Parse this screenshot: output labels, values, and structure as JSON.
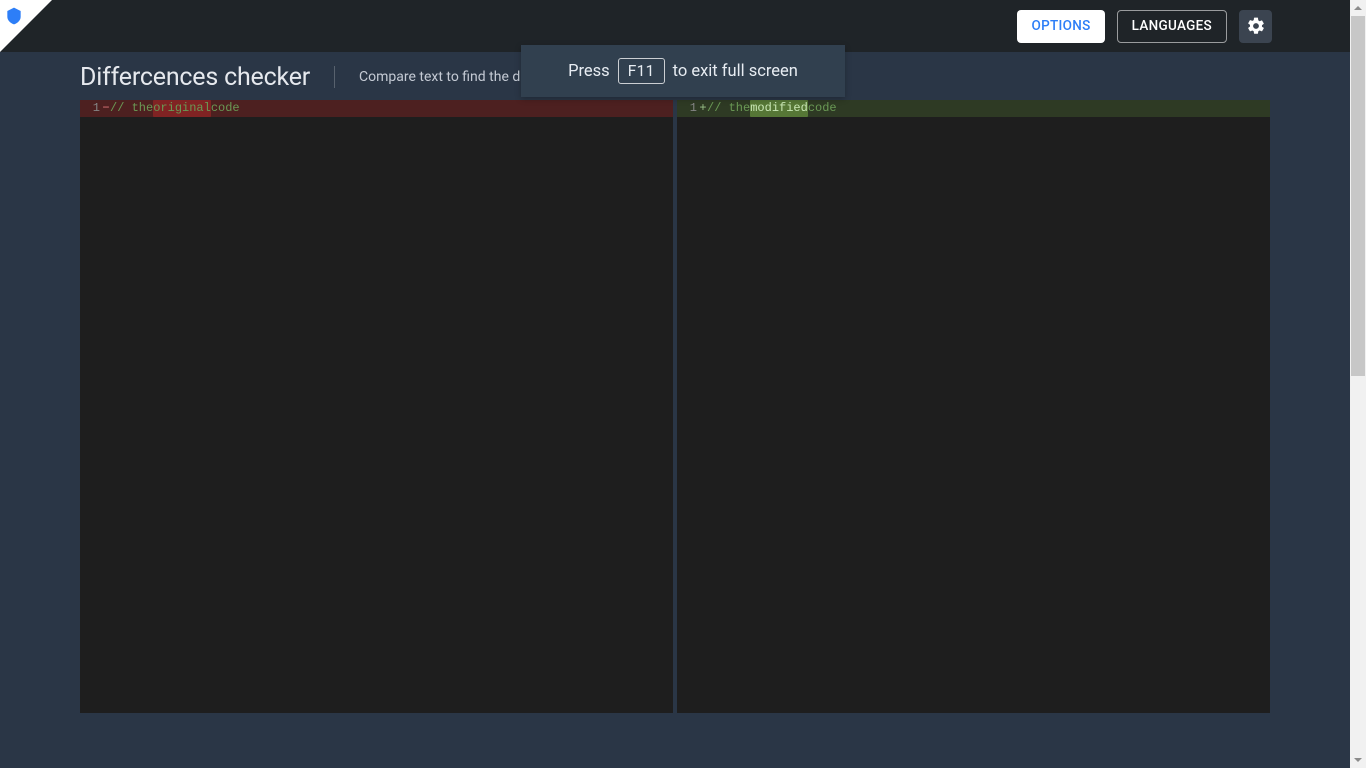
{
  "header": {
    "options_label": "OPTIONS",
    "languages_label": "LANGUAGES"
  },
  "title": {
    "main": "Differcences checker",
    "sub": "Compare text to find the difference between two text files."
  },
  "diff": {
    "left": {
      "line_number": "1",
      "sign": "−",
      "prefix": "// the ",
      "changed": "original",
      "suffix": " code"
    },
    "right": {
      "line_number": "1",
      "sign": "+",
      "prefix": "// the ",
      "changed": "modified",
      "suffix": " code"
    }
  },
  "overlay": {
    "before": "Press",
    "key": "F11",
    "after": "to exit full screen"
  }
}
